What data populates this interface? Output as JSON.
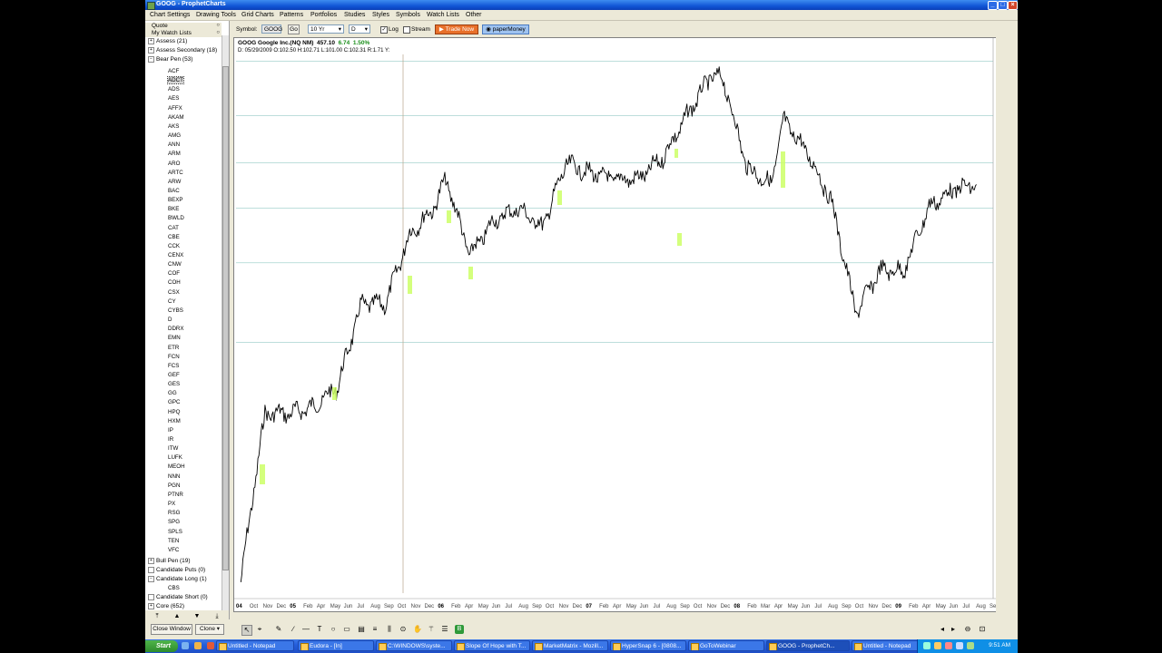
{
  "window": {
    "title": "GOOG - ProphetCharts"
  },
  "menu": [
    "Chart Settings",
    "Drawing Tools",
    "Grid Charts",
    "Patterns",
    "Portfolios",
    "Studies",
    "Styles",
    "Symbols",
    "Watch Lists",
    "Other"
  ],
  "sidebar": {
    "quote_label": "Quote",
    "watchlists_label": "My Watch Lists",
    "groups_top": [
      "Assess (21)",
      "Assess Secondary (18)",
      "Bear Pen (53)"
    ],
    "bear_pen_symbols": [
      "ACF",
      "ADCT",
      "ADS",
      "AES",
      "AFFX",
      "AKAM",
      "AKS",
      "AMG",
      "ANN",
      "ARM",
      "ARO",
      "ARTC",
      "ARW",
      "BAC",
      "BEXP",
      "BKE",
      "BWLD",
      "CAT",
      "CBE",
      "CCK",
      "CENX",
      "CNW",
      "COF",
      "COH",
      "CSX",
      "CY",
      "CYBS",
      "D",
      "DDRX",
      "EMN",
      "ETR",
      "FCN",
      "FCS",
      "GEF",
      "GES",
      "GG",
      "GPC",
      "HPQ",
      "HXM",
      "IP",
      "IR",
      "ITW",
      "LUFK",
      "MEOH",
      "NNN",
      "PGN",
      "PTNR",
      "PX",
      "RSG",
      "SPG",
      "SPLS",
      "TEN",
      "VFC"
    ],
    "selected_symbol": "ADCT",
    "groups_bottom": [
      "Bull Pen (19)",
      "Candidate Puts (0)",
      "Candidate Long (1)"
    ],
    "candidate_long_symbol": "CBS",
    "groups_end": [
      "Candidate Short (0)",
      "Core (652)"
    ],
    "close_window_label": "Close Window",
    "clone_label": "Clone"
  },
  "toolbar": {
    "symbol_label": "Symbol:",
    "symbol_value": "GOOG",
    "go_label": "Go",
    "range_value": "10 Yr",
    "interval_value": "D",
    "log_label": "Log",
    "stream_label": "Stream",
    "trade_now_label": "Trade Now",
    "paper_money_label": "paperMoney"
  },
  "chart": {
    "header_name": "GOOG Google Inc.(NQ NM)",
    "header_price": "457.10",
    "header_change": "6.74",
    "header_pct": "1.50%",
    "ohlc_line": "D: 05/29/2009 O:102.50 H:102.71 L:101.00 C:102.31 R:1.71 Y:",
    "colors": {
      "price": "#000000",
      "highlight": "#ccff66",
      "gridline": "#a7d3cf",
      "up": "#1a8f1a",
      "axis_text": "#7a2a00"
    }
  },
  "chart_data": {
    "type": "line",
    "title": "GOOG Google Inc.(NQ NM)",
    "y_scale": "log",
    "ylim": [
      95,
      760
    ],
    "yticks": [
      100,
      110,
      120,
      130,
      140,
      150,
      160,
      170,
      180,
      190,
      200,
      210,
      220,
      230,
      240,
      250,
      260,
      270,
      280,
      290,
      300,
      310,
      320,
      330,
      340,
      360,
      380,
      400,
      420,
      440,
      460,
      480,
      500,
      520,
      540,
      560,
      580,
      600,
      620,
      640,
      660,
      680,
      700,
      720,
      740
    ],
    "xtick_labels": [
      "04",
      "Oct",
      "Nov",
      "Dec",
      "05",
      "Feb",
      "Apr",
      "May",
      "Jun",
      "Jul",
      "Aug",
      "Sep",
      "Oct",
      "Nov",
      "Dec",
      "06",
      "Feb",
      "Apr",
      "May",
      "Jun",
      "Jul",
      "Aug",
      "Sep",
      "Oct",
      "Nov",
      "Dec",
      "07",
      "Feb",
      "Apr",
      "May",
      "Jun",
      "Jul",
      "Aug",
      "Sep",
      "Oct",
      "Nov",
      "Dec",
      "08",
      "Feb",
      "Mar",
      "Apr",
      "May",
      "Jun",
      "Jul",
      "Aug",
      "Sep",
      "Oct",
      "Nov",
      "Dec",
      "09",
      "Feb",
      "Apr",
      "May",
      "Jun",
      "Jul",
      "Aug",
      "Sep"
    ],
    "horizontal_lines": [
      740,
      600,
      500,
      420,
      340,
      250
    ],
    "x": [
      "2004-08",
      "2004-10",
      "2004-12",
      "2005-02",
      "2005-04",
      "2005-06",
      "2005-08",
      "2005-10",
      "2005-12",
      "2006-01",
      "2006-03",
      "2006-05",
      "2006-07",
      "2006-09",
      "2006-11",
      "2007-01",
      "2007-03",
      "2007-05",
      "2007-07",
      "2007-09",
      "2007-11",
      "2007-12",
      "2008-02",
      "2008-04",
      "2008-05",
      "2008-07",
      "2008-09",
      "2008-11",
      "2009-01",
      "2009-03",
      "2009-05",
      "2009-07",
      "2009-09"
    ],
    "series": [
      {
        "values": [
          100,
          190,
          190,
          195,
          210,
          290,
          290,
          380,
          420,
          470,
          350,
          400,
          420,
          390,
          500,
          480,
          470,
          470,
          510,
          600,
          700,
          690,
          490,
          460,
          590,
          520,
          430,
          280,
          330,
          330,
          420,
          450,
          460
        ]
      }
    ]
  },
  "taskbar": {
    "start_label": "Start",
    "tasks": [
      "Untitled - Notepad",
      "Eudora - [In]",
      "C:\\WINDOWS\\syste...",
      "Slope Of Hope with T...",
      "MarketMatrix - Mozill...",
      "HyperSnap 6 - [0808...",
      "GoToWebinar",
      "GOOG - ProphetCh...",
      "Untitled - Notepad"
    ],
    "active_task_index": 7,
    "clock": "9:51 AM"
  }
}
